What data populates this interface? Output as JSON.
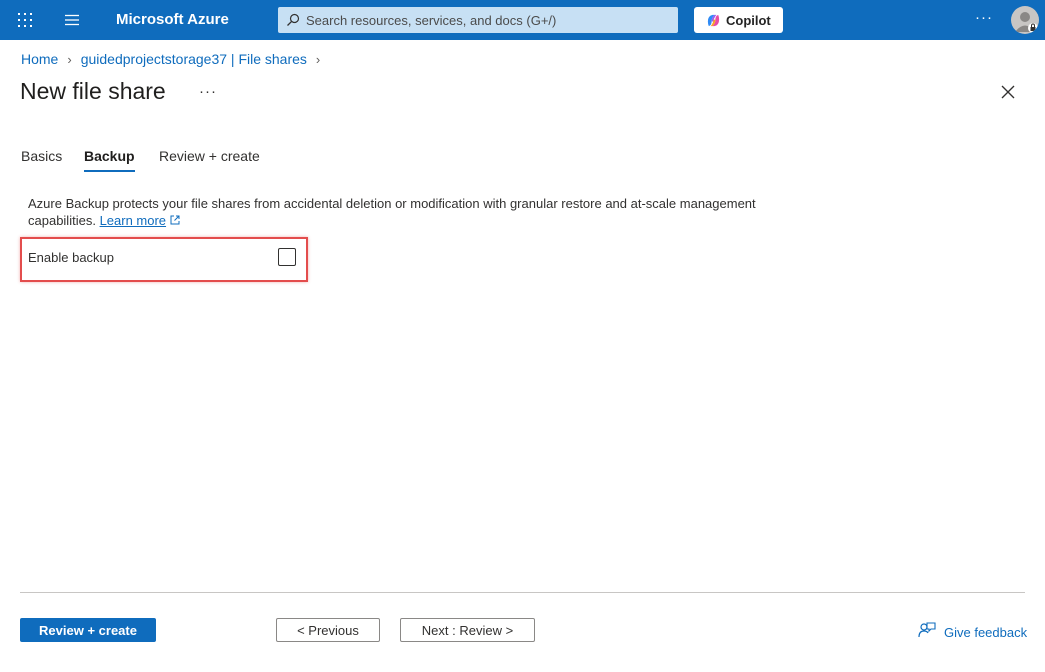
{
  "topbar": {
    "brand": "Microsoft Azure",
    "search_placeholder": "Search resources, services, and docs (G+/)",
    "copilot_label": "Copilot",
    "more_label": "···"
  },
  "breadcrumb": {
    "items": [
      "Home",
      "guidedprojectstorage37 | File shares"
    ]
  },
  "page": {
    "title": "New file share",
    "more_label": "···"
  },
  "tabs": [
    {
      "label": "Basics",
      "active": false
    },
    {
      "label": "Backup",
      "active": true
    },
    {
      "label": "Review + create",
      "active": false
    }
  ],
  "backup": {
    "description": "Azure Backup protects your file shares from accidental deletion or modification with granular restore and at-scale management capabilities.",
    "learn_more": "Learn more",
    "enable_label": "Enable backup",
    "enable_checked": false
  },
  "footer": {
    "review_create": "Review + create",
    "previous": "< Previous",
    "next": "Next : Review >",
    "feedback": "Give feedback"
  },
  "colors": {
    "accent": "#0f6cbd",
    "highlight": "#e34d4d"
  },
  "icons": [
    "waffle-icon",
    "hamburger-icon",
    "search-icon",
    "copilot-icon",
    "avatar-icon",
    "chevron-right-icon",
    "close-icon",
    "external-link-icon",
    "feedback-icon"
  ]
}
